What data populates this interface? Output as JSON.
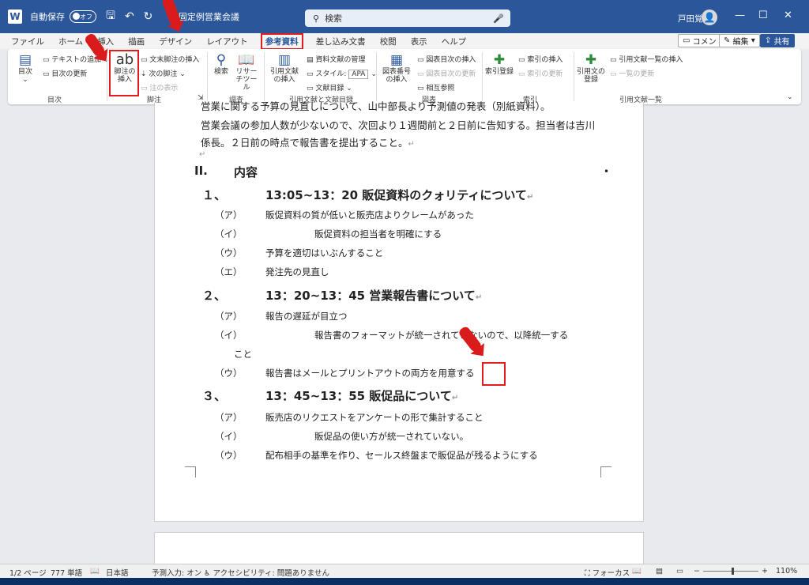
{
  "titlebar": {
    "app_icon": "W",
    "autosave_label": "自動保存",
    "toggle_label": "オフ",
    "doc_name": "1 固定例営業会議",
    "search_placeholder": "検索",
    "username": "戸田覚"
  },
  "tabs": [
    "ファイル",
    "ホーム",
    "挿入",
    "描画",
    "デザイン",
    "レイアウト",
    "参考資料",
    "差し込み文書",
    "校閲",
    "表示",
    "ヘルプ"
  ],
  "active_tab": "参考資料",
  "tab_right": {
    "comment": "コメント",
    "edit": "編集",
    "share": "共有"
  },
  "ribbon": {
    "toc": "目次",
    "add_text": "テキストの追加",
    "update_toc": "目次の更新",
    "group_toc": "目次",
    "insert_footnote_icon": "ab",
    "insert_footnote": "脚注の挿入",
    "insert_endnote": "文末脚注の挿入",
    "next_footnote": "次の脚注",
    "show_notes": "注の表示",
    "group_footnotes": "脚注",
    "search": "検索",
    "researcher": "リサーチツール",
    "group_research": "調査",
    "insert_citation": "引用文献の挿入",
    "manage_sources": "資料文献の管理",
    "style_label": "スタイル:",
    "style_value": "APA",
    "bibliography": "文献目録",
    "group_citations": "引用文献と文献目録",
    "insert_caption": "図表番号の挿入",
    "insert_table_figures": "図表目次の挿入",
    "update_table": "図表目次の更新",
    "cross_reference": "相互参照",
    "group_captions": "図表",
    "mark_entry": "索引登録",
    "insert_index": "索引の挿入",
    "update_index": "索引の更新",
    "group_index": "索引",
    "mark_citation": "引用文の登録",
    "insert_toa": "引用文献一覧の挿入",
    "update_toa": "一覧の更新",
    "group_toa": "引用文献一覧"
  },
  "document": {
    "line0": "営業に関する予算の見直しについて、山中部長より予測値の発表（別紙資料）。",
    "line1": "営業会議の参加人数が少ないので、次回より１週間前と２日前に告知する。担当者は吉川",
    "line2": "係長。２日前の時点で報告書を提出すること。",
    "section_num": "II.",
    "section_title": "内容",
    "h1_num": "１、",
    "h1": "13:05~13：20 販促資料のクォリティについて",
    "h1_items": [
      {
        "label": "（ア）",
        "text": "販促資料の質が低いと販売店よりクレームがあった"
      },
      {
        "label": "（イ）",
        "text": "販促資料の担当者を明確にする"
      },
      {
        "label": "（ウ）",
        "text": "予算を適切はいぶんすること"
      },
      {
        "label": "（エ）",
        "text": "発注先の見直し"
      }
    ],
    "h2_num": "２、",
    "h2": "13：20~13：45 営業報告書について",
    "h2_items": [
      {
        "label": "（ア）",
        "text": "報告の遅延が目立つ"
      },
      {
        "label": "（イ）",
        "text": "報告書のフォーマットが統一されていないので、以降統一する"
      },
      {
        "label": "",
        "text": "こと"
      },
      {
        "label": "（ウ）",
        "text": "報告書はメールとプリントアウトの両方を用意する"
      }
    ],
    "h3_num": "３、",
    "h3": "13：45~13：55 販促品について",
    "h3_items": [
      {
        "label": "（ア）",
        "text": "販売店のリクエストをアンケートの形で集計すること"
      },
      {
        "label": "（イ）",
        "text": "販促品の使い方が統一されていない。"
      },
      {
        "label": "（ウ）",
        "text": "配布相手の基準を作り、セールス終盤まで販促品が残るようにする"
      }
    ],
    "para_mark": "↵"
  },
  "status": {
    "page": "1/2 ページ",
    "words": "777 単語",
    "lang": "日本語",
    "predict": "予測入力: オン",
    "access": "アクセシビリティ: 問題ありません",
    "focus": "フォーカス",
    "zoom": "110%"
  },
  "colors": {
    "brand": "#2b579a",
    "highlight": "#e21c1c"
  }
}
